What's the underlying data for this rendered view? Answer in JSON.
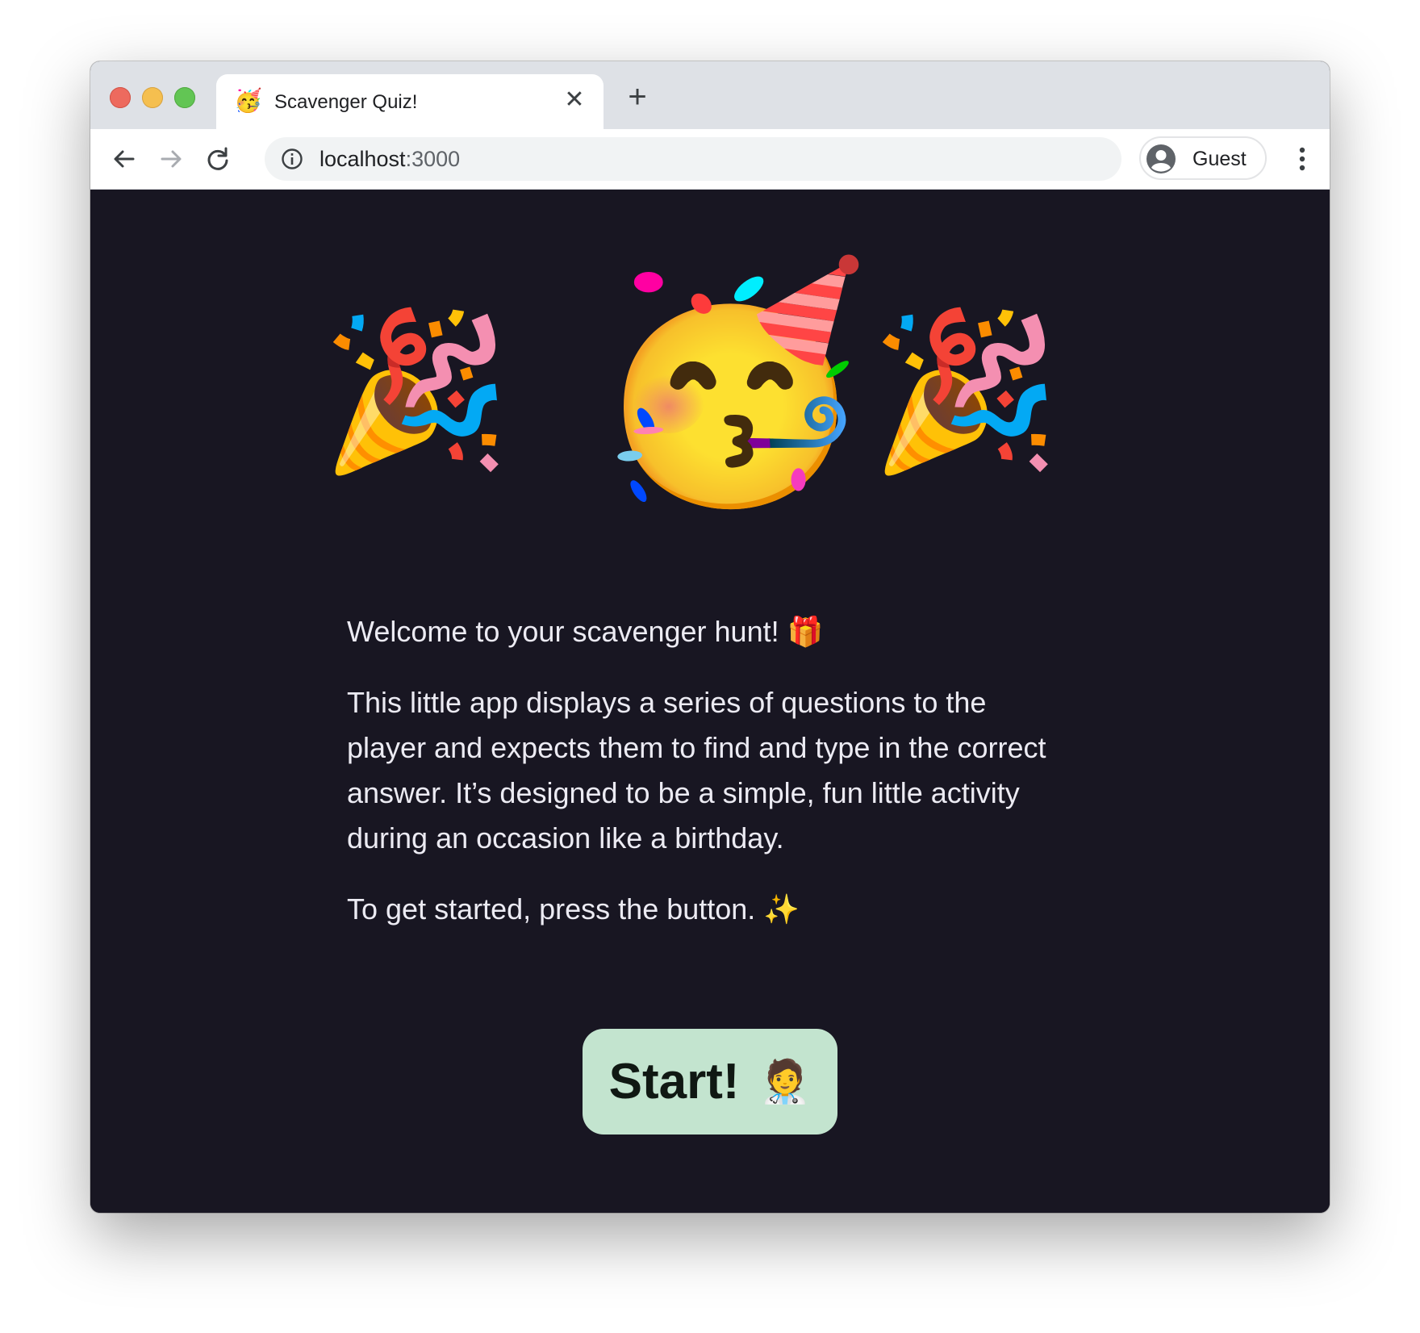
{
  "browser": {
    "tab": {
      "title": "Scavenger Quiz!",
      "favicon": "🥳"
    },
    "new_tab_symbol": "+",
    "url": {
      "host": "localhost",
      "port": ":3000"
    },
    "profile_label": "Guest"
  },
  "page": {
    "emojis": {
      "popper": "🎉",
      "party_face": "🥳"
    },
    "welcome": "Welcome to your scavenger hunt! 🎁",
    "description": "This little app displays a series of questions to the player and expects them to find and type in the correct answer. It’s designed to be a simple, fun little activity during an occasion like a birthday.",
    "instruction": "To get started, press the button. ✨",
    "start_button": {
      "label": "Start!",
      "emoji": "🧑‍⚕️"
    }
  },
  "colors": {
    "page_background": "#181622",
    "button_background": "#c3e4cf",
    "text": "#ecebf3"
  }
}
